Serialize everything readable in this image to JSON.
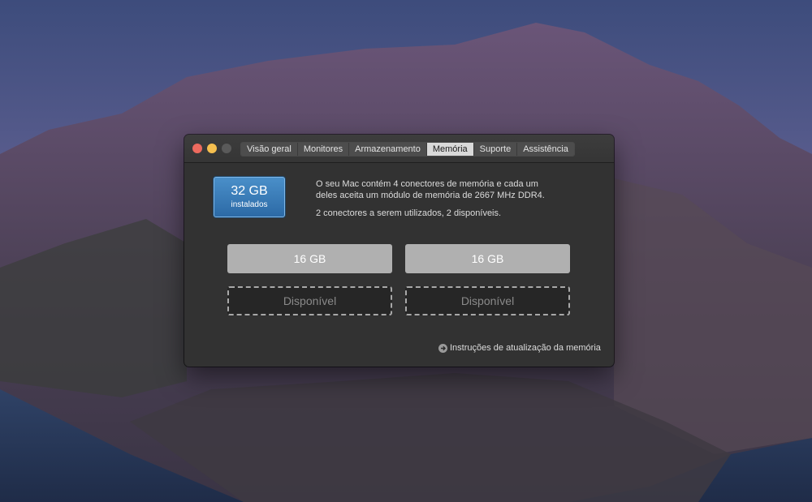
{
  "window": {
    "tabs": [
      {
        "label": "Visão geral",
        "active": false
      },
      {
        "label": "Monitores",
        "active": false
      },
      {
        "label": "Armazenamento",
        "active": false
      },
      {
        "label": "Memória",
        "active": true
      },
      {
        "label": "Suporte",
        "active": false
      },
      {
        "label": "Assistência",
        "active": false
      }
    ]
  },
  "memory": {
    "total": "32 GB",
    "total_label": "instalados",
    "description_line1": "O seu Mac contém 4 conectores de memória e cada um",
    "description_line2": "deles aceita um módulo de memória de 2667 MHz DDR4.",
    "usage_text": "2 conectores a serem utilizados, 2 disponíveis.",
    "slots": [
      {
        "label": "16 GB",
        "state": "filled"
      },
      {
        "label": "16 GB",
        "state": "filled"
      },
      {
        "label": "Disponível",
        "state": "empty"
      },
      {
        "label": "Disponível",
        "state": "empty"
      }
    ],
    "upgrade_link": "Instruções de atualização da memória"
  },
  "colors": {
    "badge": "#2c6aa6",
    "close": "#ed6a5e",
    "minimize": "#f5bf4f"
  }
}
